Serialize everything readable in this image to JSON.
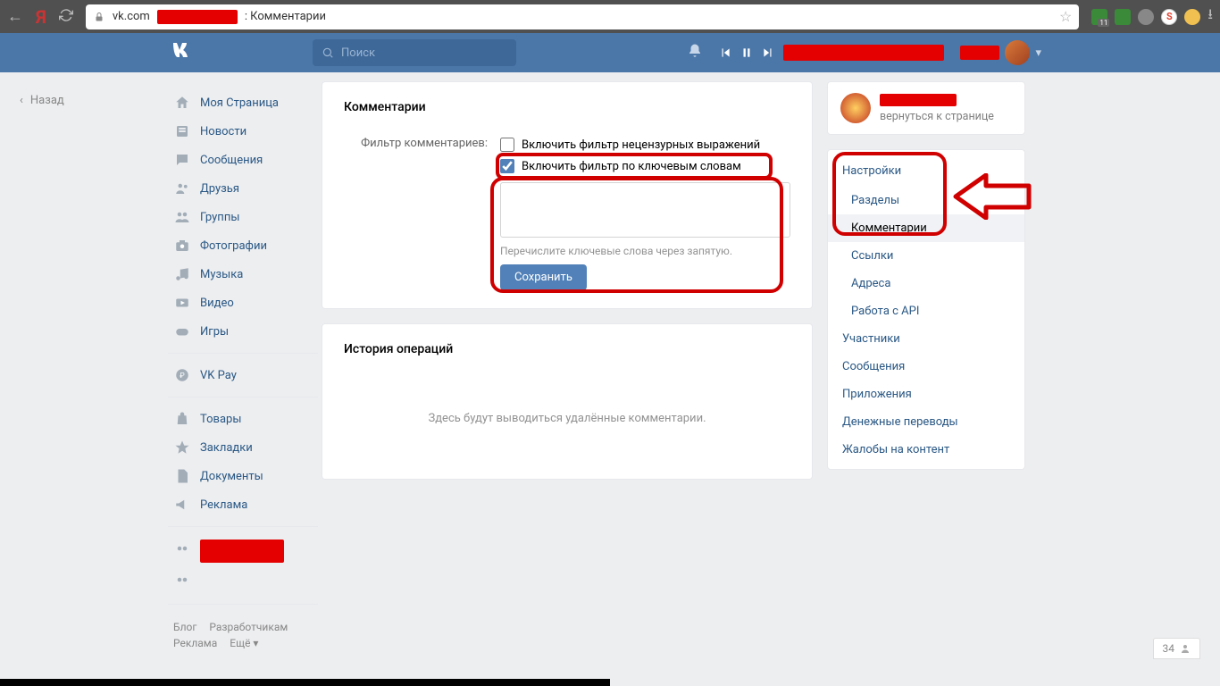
{
  "chrome": {
    "url_host": "vk.com",
    "title_suffix": ": Комментарии",
    "ext_badge": "11"
  },
  "topbar": {
    "search_placeholder": "Поиск"
  },
  "back_link": "Назад",
  "leftnav": {
    "items": [
      {
        "icon": "home",
        "label": "Моя Страница"
      },
      {
        "icon": "news",
        "label": "Новости"
      },
      {
        "icon": "msg",
        "label": "Сообщения"
      },
      {
        "icon": "friends",
        "label": "Друзья"
      },
      {
        "icon": "groups",
        "label": "Группы"
      },
      {
        "icon": "photo",
        "label": "Фотографии"
      },
      {
        "icon": "music",
        "label": "Музыка"
      },
      {
        "icon": "video",
        "label": "Видео"
      },
      {
        "icon": "games",
        "label": "Игры"
      }
    ],
    "items2": [
      {
        "icon": "pay",
        "label": "VK Pay"
      }
    ],
    "items3": [
      {
        "icon": "market",
        "label": "Товары"
      },
      {
        "icon": "fav",
        "label": "Закладки"
      },
      {
        "icon": "docs",
        "label": "Документы"
      },
      {
        "icon": "ads",
        "label": "Реклама"
      }
    ],
    "footer": [
      "Блог",
      "Разработчикам",
      "Реклама",
      "Ещё ▾"
    ]
  },
  "main": {
    "heading": "Комментарии",
    "filter_label": "Фильтр комментариев:",
    "chk1_label": "Включить фильтр нецензурных выражений",
    "chk1_checked": false,
    "chk2_label": "Включить фильтр по ключевым словам",
    "chk2_checked": true,
    "keywords_hint": "Перечислите ключевые слова через запятую.",
    "save_label": "Сохранить",
    "history_heading": "История операций",
    "history_empty": "Здесь будут выводиться удалённые комментарии."
  },
  "rightcol": {
    "return_text": "вернуться к странице",
    "settings_head": "Настройки",
    "menu": [
      {
        "label": "Разделы",
        "indent": true
      },
      {
        "label": "Комментарии",
        "indent": true,
        "active": true
      },
      {
        "label": "Ссылки",
        "indent": true
      },
      {
        "label": "Адреса",
        "indent": true
      },
      {
        "label": "Работа с API",
        "indent": true
      },
      {
        "label": "Участники"
      },
      {
        "label": "Сообщения"
      },
      {
        "label": "Приложения"
      },
      {
        "label": "Денежные переводы"
      },
      {
        "label": "Жалобы на контент"
      }
    ]
  },
  "status": {
    "count": "34"
  }
}
